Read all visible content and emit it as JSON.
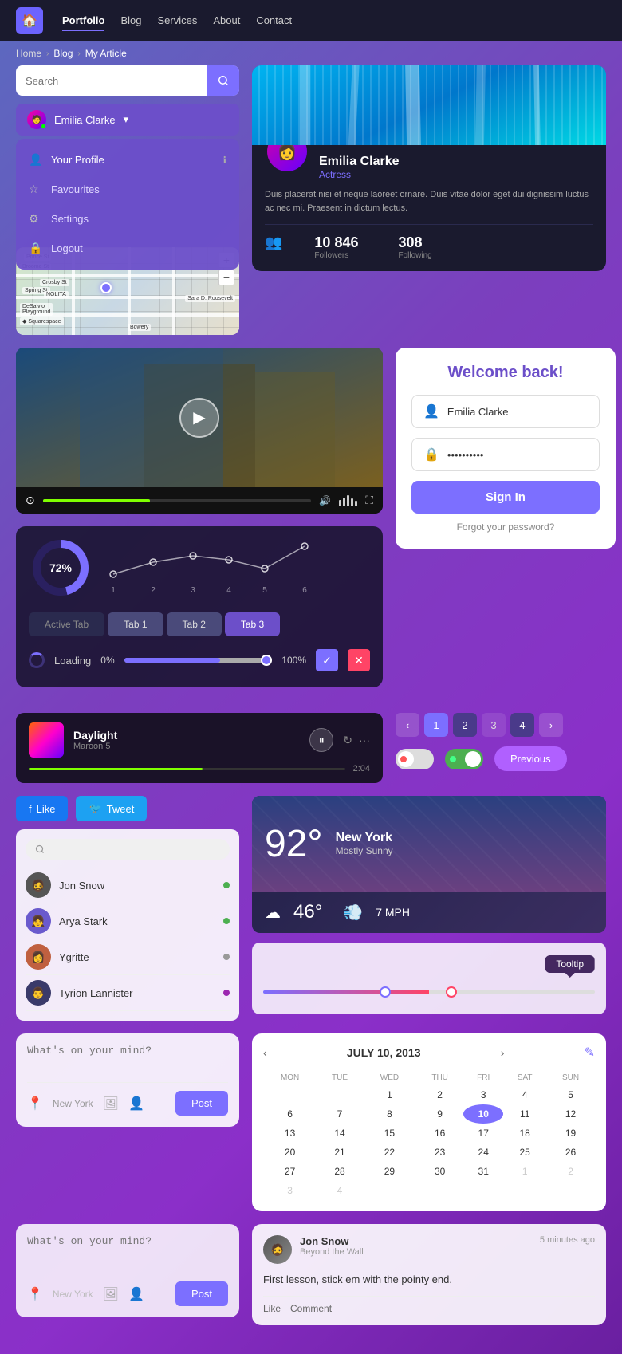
{
  "nav": {
    "logo_icon": "🏠",
    "links": [
      "Portfolio",
      "Blog",
      "Services",
      "About",
      "Contact"
    ],
    "active_link": "Portfolio"
  },
  "breadcrumb": {
    "items": [
      "Home",
      "Blog",
      "My Article"
    ]
  },
  "search": {
    "placeholder": "Search",
    "icon": "🔍"
  },
  "user_dropdown": {
    "name": "Emilia Clarke",
    "items": [
      {
        "label": "Your Profile",
        "icon": "👤"
      },
      {
        "label": "Favourites",
        "icon": "☆"
      },
      {
        "label": "Settings",
        "icon": "⚙"
      },
      {
        "label": "Logout",
        "icon": "🔒"
      }
    ]
  },
  "profile_card": {
    "name": "Emilia Clarke",
    "role": "Actress",
    "bio": "Duis placerat nisi et neque laoreet ornare. Duis vitae dolor eget dui dignissim luctus ac nec mi. Praesent in dictum lectus.",
    "followers": "10 846",
    "following": "308",
    "followers_label": "Followers",
    "following_label": "Following"
  },
  "video": {
    "progress_pct": 40,
    "volume_icon": "🔊"
  },
  "analytics": {
    "donut_pct": 72,
    "donut_label": "72%",
    "line_points": [
      {
        "x": 1,
        "y": 55
      },
      {
        "x": 2,
        "y": 35
      },
      {
        "x": 3,
        "y": 25
      },
      {
        "x": 4,
        "y": 30
      },
      {
        "x": 5,
        "y": 45
      },
      {
        "x": 6,
        "y": 15
      }
    ],
    "x_labels": [
      "1",
      "2",
      "3",
      "4",
      "5",
      "6"
    ]
  },
  "tabs": {
    "items": [
      "Active Tab",
      "Tab 1",
      "Tab 2",
      "Tab 3"
    ]
  },
  "loading": {
    "label": "Loading",
    "pct": "0%",
    "max": "100%",
    "fill_pct": 65
  },
  "welcome": {
    "title": "Welcome back!",
    "username_placeholder": "Emilia Clarke",
    "password_placeholder": "••••••••••",
    "sign_in_label": "Sign In",
    "forgot_label": "Forgot your password?"
  },
  "music": {
    "title": "Daylight",
    "artist": "Maroon 5",
    "duration": "2:04",
    "fill_pct": 55
  },
  "pagination": {
    "pages": [
      "1",
      "2",
      "3",
      "4"
    ],
    "prev_label": "Previous"
  },
  "social_buttons": {
    "like": "Like",
    "tweet": "Tweet"
  },
  "users": [
    {
      "name": "Jon Snow",
      "status": "green",
      "avatar_bg": "#555"
    },
    {
      "name": "Arya Stark",
      "status": "green",
      "avatar_bg": "#6a5acd"
    },
    {
      "name": "Ygritte",
      "status": "gray",
      "avatar_bg": "#c06040"
    },
    {
      "name": "Tyrion Lannister",
      "status": "purple",
      "avatar_bg": "#3a3a6a"
    }
  ],
  "weather": {
    "temp": "92°",
    "city": "New York",
    "desc": "Mostly Sunny",
    "cold": "46°",
    "wind": "7 MPH"
  },
  "tooltip": {
    "label": "Tooltip"
  },
  "calendar": {
    "month": "JULY 10, 2013",
    "days_of_week": [
      "MON",
      "TUE",
      "WED",
      "THU",
      "FRI",
      "SAT",
      "SUN"
    ],
    "weeks": [
      [
        "",
        "",
        "1",
        "2",
        "3",
        "4",
        "5"
      ],
      [
        "6",
        "7",
        "8",
        "9",
        "10",
        "11",
        "12"
      ],
      [
        "13",
        "14",
        "15",
        "16",
        "17",
        "18",
        "19"
      ],
      [
        "20",
        "21",
        "22",
        "23",
        "24",
        "25",
        "26"
      ],
      [
        "27",
        "28",
        "29",
        "30",
        "31",
        "1",
        "2"
      ],
      [
        "3",
        "4",
        "",
        "",
        "",
        "",
        ""
      ]
    ],
    "today": "10",
    "other_month_start": [
      "1",
      "2"
    ],
    "other_month_end": [
      "1",
      "2",
      "3",
      "4"
    ]
  },
  "post": {
    "placeholder": "What's on your mind?",
    "location": "New York",
    "post_label": "Post"
  },
  "social_post": {
    "user": "Jon Snow",
    "subtitle": "Beyond the Wall",
    "time": "5 minutes ago",
    "content": "First lesson, stick em with the pointy end.",
    "like": "Like",
    "comment": "Comment"
  }
}
